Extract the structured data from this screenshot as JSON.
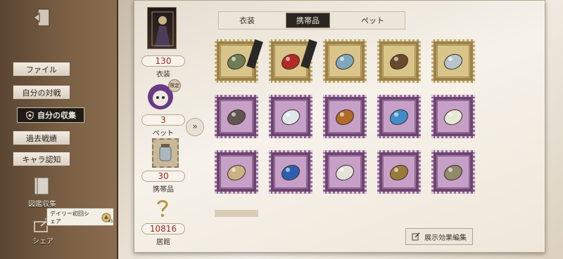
{
  "sidebar": {
    "items": [
      {
        "label": "ファイル"
      },
      {
        "label": "自分の対戦"
      },
      {
        "label": "自分の収集"
      },
      {
        "label": "過去戦績"
      },
      {
        "label": "キャラ認知"
      }
    ],
    "book_label": "図鑑収集",
    "share_label": "シェア",
    "tooltip_line1": "デイリー初回シ",
    "tooltip_line2": "ェア",
    "tooltip_reward": "x5"
  },
  "stats": {
    "costume_count": "130",
    "costume_label": "衣装",
    "pet_tag": "限定",
    "pet_count": "3",
    "pet_label": "ペット",
    "accessory_count": "30",
    "accessory_label": "携帯品",
    "residence_count": "10816",
    "residence_label": "居館"
  },
  "tabs": [
    {
      "label": "衣装"
    },
    {
      "label": "携帯品",
      "active": true
    },
    {
      "label": "ペット"
    }
  ],
  "items": [
    {
      "icon": "wine-bottle-icon",
      "frame": "gold",
      "ribbon": true
    },
    {
      "icon": "red-book-icon",
      "frame": "gold",
      "ribbon": true
    },
    {
      "icon": "glass-box-icon",
      "frame": "gold"
    },
    {
      "icon": "torch-icon",
      "frame": "gold"
    },
    {
      "icon": "jar-icon",
      "frame": "gold"
    },
    {
      "icon": "stone-icon",
      "frame": "purple"
    },
    {
      "icon": "ghost-icon",
      "frame": "purple"
    },
    {
      "icon": "crab-icon",
      "frame": "purple"
    },
    {
      "icon": "whale-icon",
      "frame": "purple"
    },
    {
      "icon": "orb-icon",
      "frame": "purple"
    },
    {
      "icon": "scroll-icon",
      "frame": "purple"
    },
    {
      "icon": "umbrella-icon",
      "frame": "purple"
    },
    {
      "icon": "crystal-icon",
      "frame": "purple"
    },
    {
      "icon": "lantern-icon",
      "frame": "purple"
    },
    {
      "icon": "dragonfly-icon",
      "frame": "purple"
    }
  ],
  "edit_button_label": "展示効果編集",
  "colors": {
    "accent_red": "#9a2a24",
    "gold_frame": "#b59a5a",
    "purple_frame": "#8a5e8c",
    "active_tab": "#2a2622"
  }
}
